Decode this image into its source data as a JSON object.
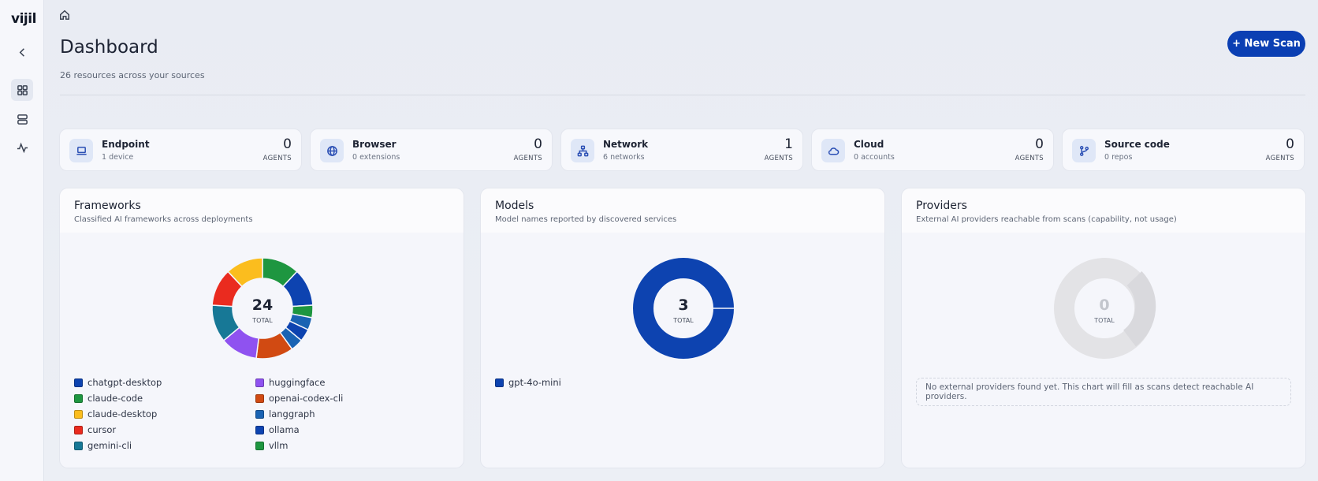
{
  "app": {
    "logo": "vijil"
  },
  "header": {
    "title": "Dashboard",
    "subtitle": "26 resources across your sources",
    "new_scan_label": "+ New Scan"
  },
  "sidebar": {
    "items": [
      {
        "name": "collapse",
        "icon": "chevron-left-icon"
      },
      {
        "name": "dashboard",
        "icon": "grid-icon"
      },
      {
        "name": "resources",
        "icon": "server-icon"
      },
      {
        "name": "activity",
        "icon": "activity-icon"
      }
    ]
  },
  "stats": [
    {
      "label": "Endpoint",
      "sub": "1 device",
      "value": "0",
      "unit": "AGENTS",
      "icon": "laptop-icon"
    },
    {
      "label": "Browser",
      "sub": "0 extensions",
      "value": "0",
      "unit": "AGENTS",
      "icon": "globe-icon"
    },
    {
      "label": "Network",
      "sub": "6 networks",
      "value": "1",
      "unit": "AGENTS",
      "icon": "network-icon"
    },
    {
      "label": "Cloud",
      "sub": "0 accounts",
      "value": "0",
      "unit": "AGENTS",
      "icon": "cloud-icon"
    },
    {
      "label": "Source code",
      "sub": "0 repos",
      "value": "0",
      "unit": "AGENTS",
      "icon": "git-branch-icon"
    }
  ],
  "panels": {
    "frameworks": {
      "title": "Frameworks",
      "subtitle": "Classified AI frameworks across deployments",
      "total": "24",
      "total_label": "TOTAL"
    },
    "models": {
      "title": "Models",
      "subtitle": "Model names reported by discovered services",
      "total": "3",
      "total_label": "TOTAL"
    },
    "providers": {
      "title": "Providers",
      "subtitle": "External AI providers reachable from scans (capability, not usage)",
      "total": "0",
      "total_label": "TOTAL",
      "empty_message": "No external providers found yet. This chart will fill as scans detect reachable AI providers."
    }
  },
  "chart_data": [
    {
      "type": "pie",
      "categories": [
        "claude-code",
        "chatgpt-desktop",
        "vllm",
        "langgraph",
        "ollama",
        "langgraph",
        "openai-codex-cli",
        "huggingface",
        "gemini-cli",
        "cursor",
        "claude-desktop"
      ],
      "values": [
        3,
        3,
        1,
        1,
        1,
        1,
        3,
        3,
        3,
        3,
        3
      ],
      "colors": [
        "#1e9640",
        "#0d43b0",
        "#1e9640",
        "#1a63b3",
        "#0d43b0",
        "#1a63b3",
        "#d14a12",
        "#8f52f0",
        "#177896",
        "#ea2b1f",
        "#fbbd1e"
      ],
      "total": 24
    },
    {
      "type": "pie",
      "categories": [
        "gpt-4o-mini"
      ],
      "values": [
        3
      ],
      "colors": [
        "#0d43b0"
      ],
      "total": 3
    },
    {
      "type": "pie",
      "categories": [],
      "values": [],
      "total": 0
    }
  ],
  "legends": {
    "frameworks": [
      {
        "label": "chatgpt-desktop",
        "color": "#0d43b0"
      },
      {
        "label": "claude-code",
        "color": "#1e9640"
      },
      {
        "label": "claude-desktop",
        "color": "#fbbd1e"
      },
      {
        "label": "cursor",
        "color": "#ea2b1f"
      },
      {
        "label": "gemini-cli",
        "color": "#177896"
      },
      {
        "label": "huggingface",
        "color": "#8f52f0"
      },
      {
        "label": "openai-codex-cli",
        "color": "#d14a12"
      },
      {
        "label": "langgraph",
        "color": "#1a63b3"
      },
      {
        "label": "ollama",
        "color": "#0d43b0"
      },
      {
        "label": "vllm",
        "color": "#1e9640"
      }
    ],
    "models": [
      {
        "label": "gpt-4o-mini",
        "color": "#0d43b0"
      }
    ]
  }
}
